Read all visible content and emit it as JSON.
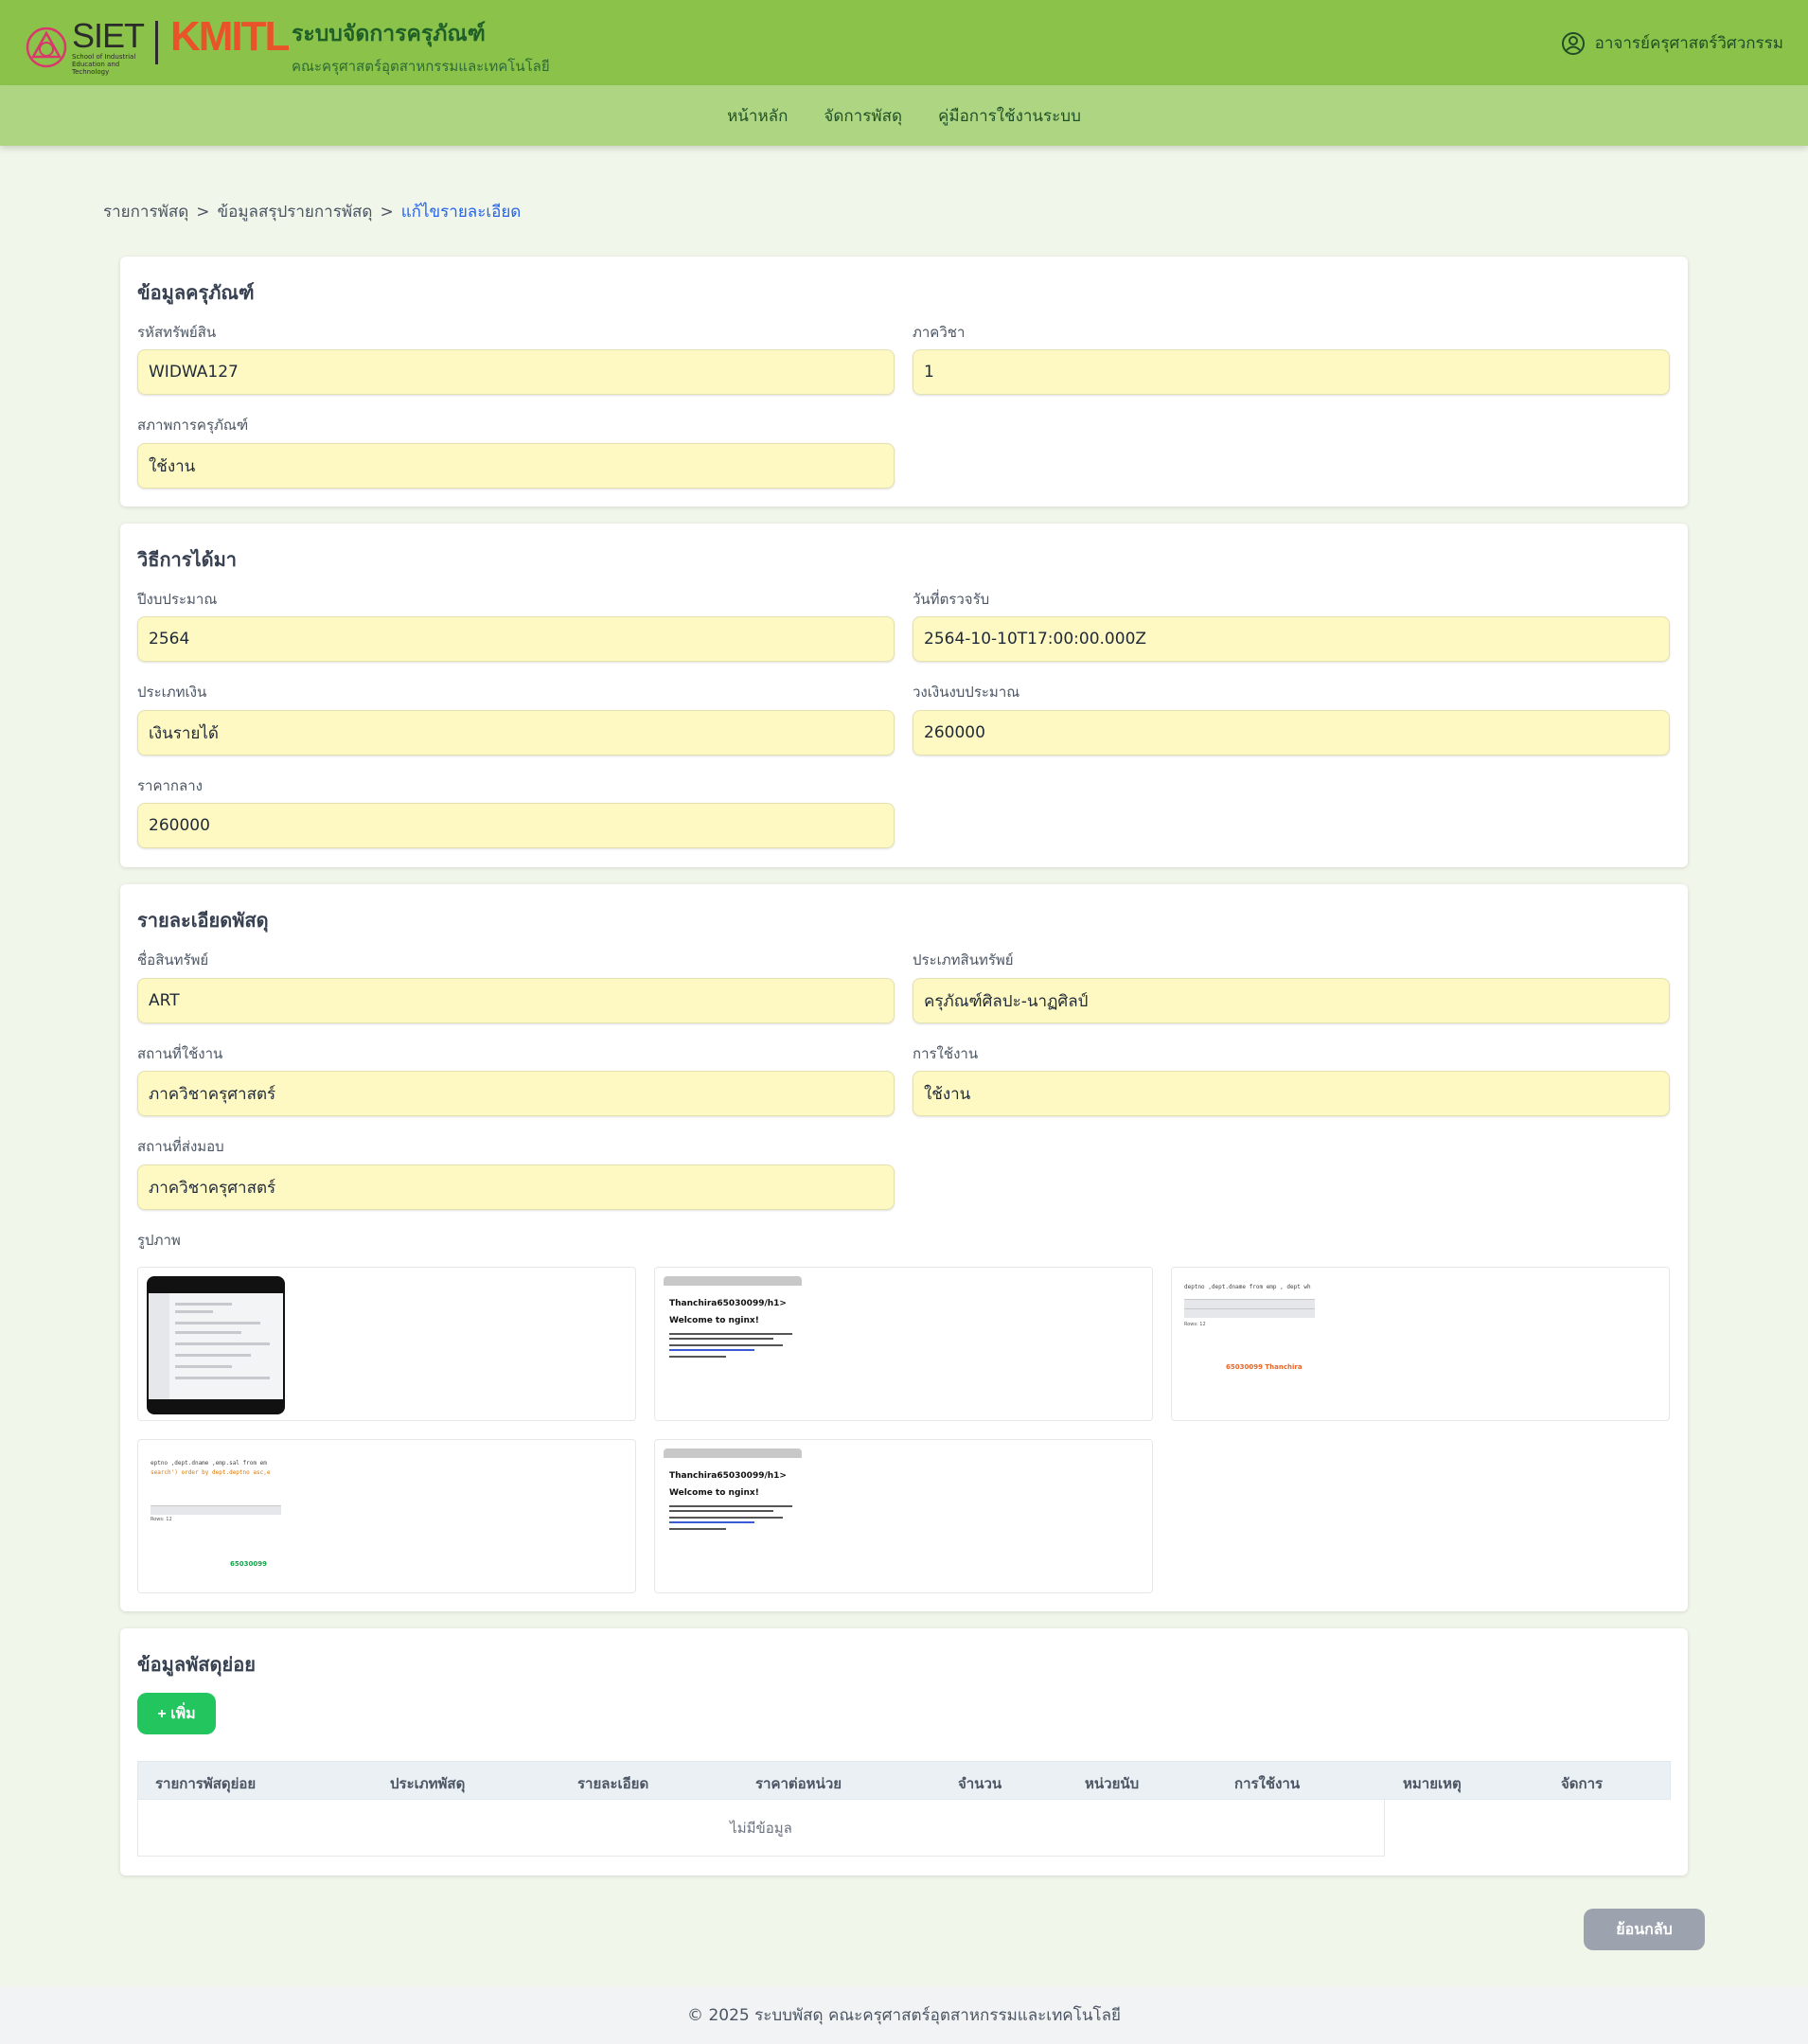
{
  "header": {
    "siet_logo_text": "SIET",
    "siet_logo_sub": "School of Industrial Education and Technology",
    "kmitl_logo_text": "KMITL",
    "app_title": "ระบบจัดการครุภัณฑ์",
    "app_subtitle": "คณะครุศาสตร์อุตสาหกรรมและเทคโนโลยี",
    "user_name": "อาจารย์ครุศาสตร์วิศวกรรม",
    "user_icon": "user-circle-icon"
  },
  "nav": {
    "items": [
      "หน้าหลัก",
      "จัดการพัสดุ",
      "คู่มือการใช้งานระบบ"
    ]
  },
  "breadcrumb": {
    "items": [
      "รายการพัสดุ",
      "ข้อมูลสรุปรายการพัสดุ"
    ],
    "current": "แก้ไขรายละเอียด",
    "separator": ">"
  },
  "equipment": {
    "title": "ข้อมูลครุภัณฑ์",
    "asset_code_label": "รหัสทรัพย์สิน",
    "asset_code": "WIDWA127",
    "department_label": "ภาควิชา",
    "department": "1",
    "condition_label": "สภาพการครุภัณฑ์",
    "condition": "ใช้งาน"
  },
  "acquisition": {
    "title": "วิธีการได้มา",
    "budget_year_label": "ปีงบประมาณ",
    "budget_year": "2564",
    "inspection_date_label": "วันที่ตรวจรับ",
    "inspection_date": "2564-10-10T17:00:00.000Z",
    "money_type_label": "ประเภทเงิน",
    "money_type": "เงินรายได้",
    "budget_amount_label": "วงเงินงบประมาณ",
    "budget_amount": "260000",
    "median_price_label": "ราคากลาง",
    "median_price": "260000"
  },
  "details": {
    "title": "รายละเอียดพัสดุ",
    "asset_name_label": "ชื่อสินทรัพย์",
    "asset_name": "ART",
    "asset_type_label": "ประเภทสินทรัพย์",
    "asset_type": "ครุภัณฑ์ศิลปะ-นาฏศิลป์",
    "location_label": "สถานที่ใช้งาน",
    "location": "ภาควิชาครุศาสตร์",
    "usage_label": "การใช้งาน",
    "usage": "ใช้งาน",
    "delivery_label": "สถานที่ส่งมอบ",
    "delivery": "ภาควิชาครุศาสตร์",
    "images_label": "รูปภาพ",
    "images": [
      {
        "kind": "app-screenshot"
      },
      {
        "kind": "nginx",
        "h1": "Thanchira65030099/h1>",
        "h2": "Welcome to nginx!"
      },
      {
        "kind": "sql",
        "code": "deptno ,dept.dname  from emp , dept wh",
        "caption": "65030099 Thanchira",
        "rows": "Rows: 12"
      },
      {
        "kind": "sql2",
        "code1": "eptno ,dept.dname ,emp.sal from  em",
        "code2": "search') order by dept.deptno asc,e",
        "caption": "65030099",
        "rows": "Rows: 12"
      },
      {
        "kind": "nginx",
        "h1": "Thanchira65030099/h1>",
        "h2": "Welcome to nginx!"
      }
    ]
  },
  "sub_items": {
    "title": "ข้อมูลพัสดุย่อย",
    "add_button": "+ เพิ่ม",
    "columns": [
      "รายการพัสดุย่อย",
      "ประเภทพัสดุ",
      "รายละเอียด",
      "ราคาต่อหน่วย",
      "จำนวน",
      "หน่วยนับ",
      "การใช้งาน",
      "หมายเหตุ",
      "จัดการ"
    ],
    "empty_text": "ไม่มีข้อมูล"
  },
  "back_button": "ย้อนกลับ",
  "footer": "© 2025 ระบบพัสดุ คณะครุศาสตร์อุตสาหกรรมและเทคโนโลยี",
  "colors": {
    "header_bg": "#8bc34a",
    "nav_bg": "#aed581",
    "page_bg": "#f1f6ea",
    "input_bg": "#fef9c3",
    "add_button": "#22c55e",
    "back_button": "#9ca3af",
    "kmitl_orange": "#e8532a"
  }
}
